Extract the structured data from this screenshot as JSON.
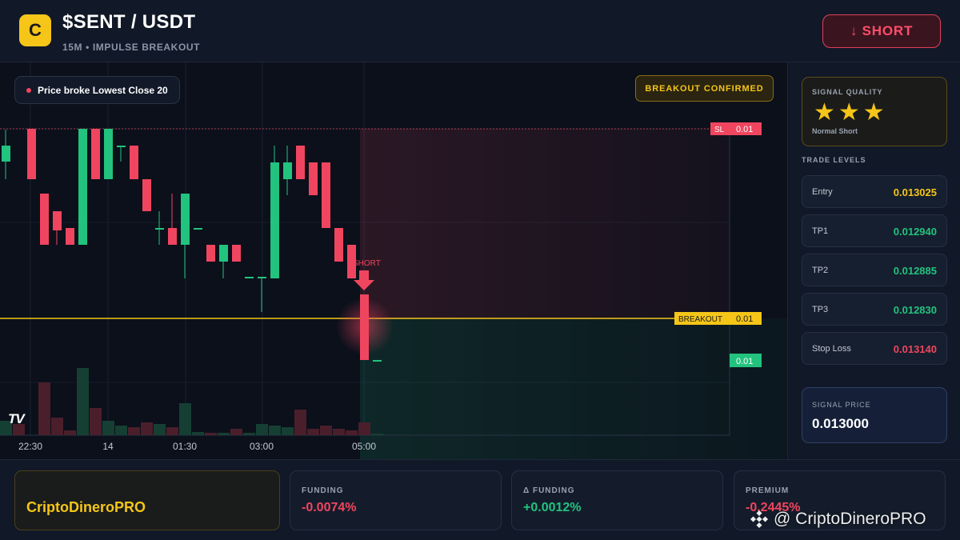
{
  "header": {
    "logo_letter": "C",
    "pair": "$SENT / USDT",
    "subtitle": "15M • IMPULSE BREAKOUT",
    "action_label": "↓ SHORT"
  },
  "chart": {
    "info_pill": "Price broke Lowest Close 20",
    "confirm_label": "BREAKOUT CONFIRMED",
    "signal_marker": "SHORT",
    "sl_tag": "SL",
    "sl_value": "0.01",
    "breakout_tag": "BREAKOUT",
    "breakout_value": "0.01",
    "last_value": "0.01",
    "x_labels": [
      "22:30",
      "14",
      "01:30",
      "03:00",
      "05:00"
    ],
    "tv_logo": "TV",
    "colors": {
      "up": "#22c37e",
      "down": "#f0455f",
      "breakout": "#f5c518"
    }
  },
  "side": {
    "quality_label": "SIGNAL QUALITY",
    "stars": "★★★",
    "quality_note": "Normal Short",
    "levels_title": "TRADE LEVELS",
    "levels": [
      {
        "label": "Entry",
        "value": "0.013025",
        "color": "#f5c518"
      },
      {
        "label": "TP1",
        "value": "0.012940",
        "color": "#22c37e"
      },
      {
        "label": "TP2",
        "value": "0.012885",
        "color": "#22c37e"
      },
      {
        "label": "TP3",
        "value": "0.012830",
        "color": "#22c37e"
      },
      {
        "label": "Stop Loss",
        "value": "0.013140",
        "color": "#f0455f"
      }
    ],
    "signal_price_label": "SIGNAL PRICE",
    "signal_price": "0.013000"
  },
  "footer": {
    "brand": "CriptoDineroPRO",
    "stats": [
      {
        "label": "FUNDING",
        "value": "-0.0074%",
        "color": "#f0455f"
      },
      {
        "label": "Δ FUNDING",
        "value": "+0.0012%",
        "color": "#22c37e"
      },
      {
        "label": "PREMIUM",
        "value": "-0.2445%",
        "color": "#f0455f"
      }
    ],
    "watermark": "@ CriptoDineroPRO"
  }
}
